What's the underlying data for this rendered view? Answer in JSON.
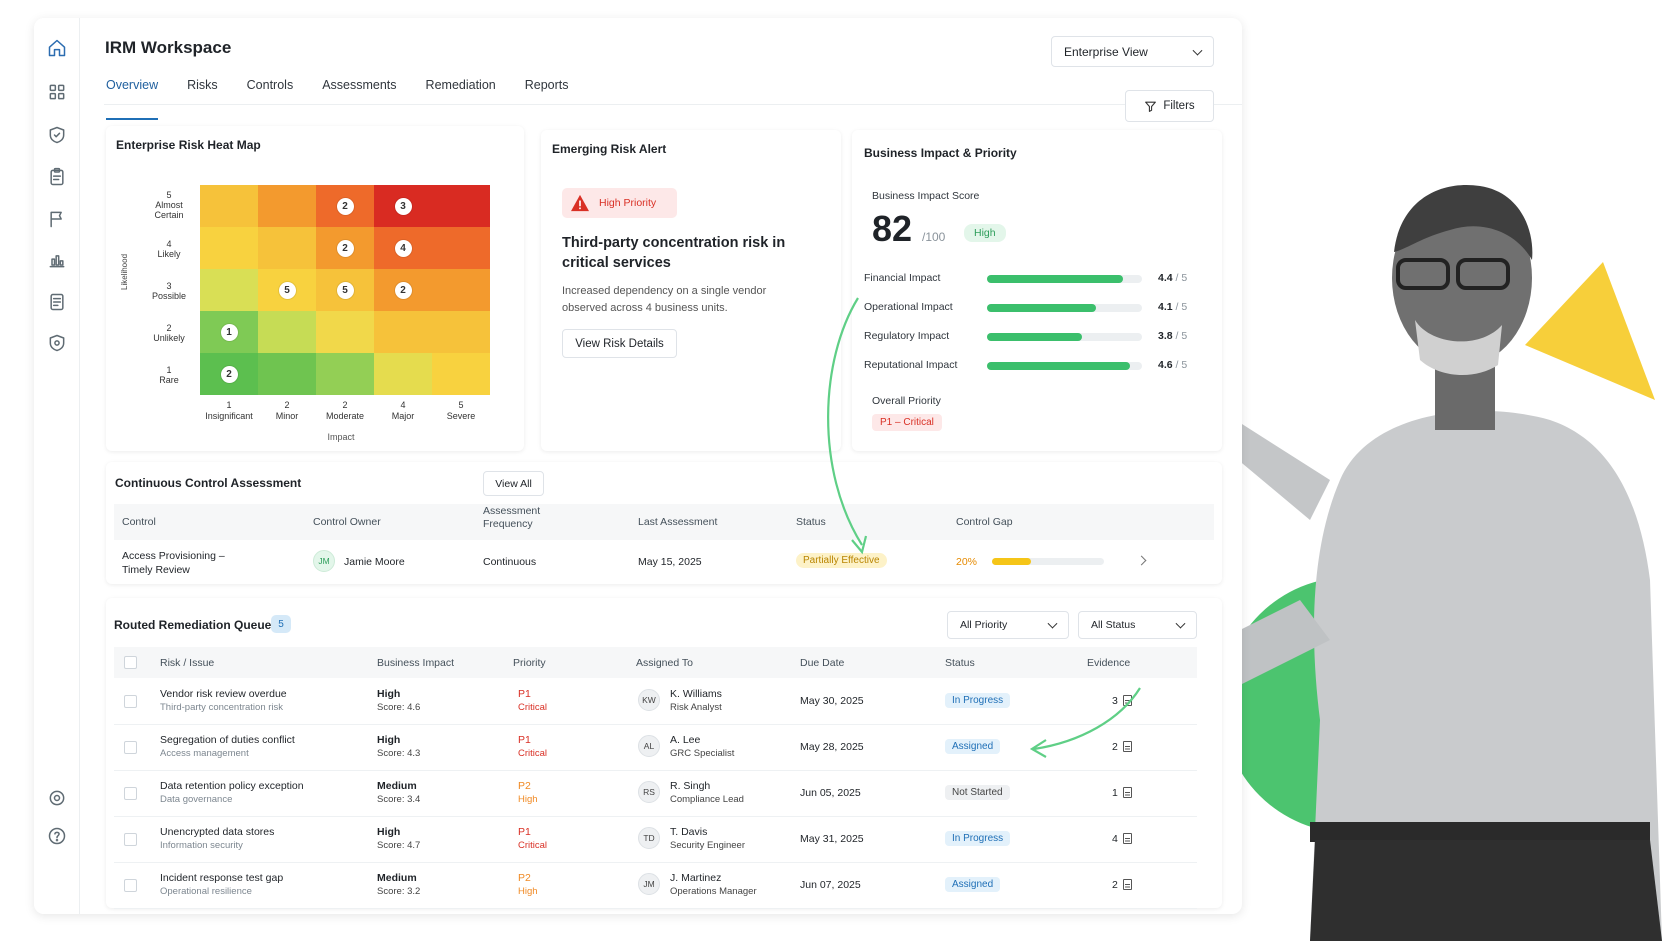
{
  "app": {
    "title": "IRM Workspace"
  },
  "tabs": [
    "Overview",
    "Risks",
    "Controls",
    "Assessments",
    "Remediation",
    "Reports"
  ],
  "view_select": "Enterprise View",
  "filters_label": "Filters",
  "rail_icons": [
    "home-icon",
    "grid-icon",
    "shield-check-icon",
    "clipboard-icon",
    "flag-icon",
    "bar-chart-icon",
    "document-icon",
    "shield-star-icon",
    "settings-icon",
    "help-icon"
  ],
  "heatmap": {
    "title": "Enterprise Risk Heat Map",
    "y_axis": "Likelihood",
    "x_axis": "Impact",
    "rows": [
      {
        "num": "5",
        "label": "Almost Certain",
        "counts": [
          "",
          "",
          "2",
          "3",
          ""
        ]
      },
      {
        "num": "4",
        "label": "Likely",
        "counts": [
          "",
          "",
          "2",
          "4",
          ""
        ]
      },
      {
        "num": "3",
        "label": "Possible",
        "counts": [
          "",
          "5",
          "5",
          "2",
          ""
        ]
      },
      {
        "num": "2",
        "label": "Unlikely",
        "counts": [
          "1",
          "",
          "",
          "",
          ""
        ]
      },
      {
        "num": "1",
        "label": "Rare",
        "counts": [
          "2",
          "",
          "",
          "",
          ""
        ]
      }
    ],
    "cols": [
      {
        "num": "1",
        "label": "Insignificant"
      },
      {
        "num": "2",
        "label": "Minor"
      },
      {
        "num": "2",
        "label": "Moderate"
      },
      {
        "num": "4",
        "label": "Major"
      },
      {
        "num": "5",
        "label": "Severe"
      }
    ],
    "colors": [
      [
        "#f6c23a",
        "#f39a2e",
        "#ee6a2a",
        "#d92b22",
        "#d92b22"
      ],
      [
        "#f8d23f",
        "#f6c23a",
        "#f39a2e",
        "#ee6a2a",
        "#ee6a2a"
      ],
      [
        "#d9df55",
        "#f8d23f",
        "#f6c23a",
        "#f39a2e",
        "#f39a2e"
      ],
      [
        "#7fca55",
        "#c6dc55",
        "#f1d84a",
        "#f6c23a",
        "#f6c23a"
      ],
      [
        "#5cbf4f",
        "#6fc450",
        "#93cf55",
        "#e5dc4e",
        "#f8d23f"
      ]
    ]
  },
  "alert": {
    "title": "Emerging Risk Alert",
    "badge": "High Priority",
    "headline": "Third-party concentration risk in critical services",
    "body": "Increased dependency on a single vendor observed across 4 business units.",
    "button": "View Risk Details"
  },
  "impact": {
    "title": "Business Impact & Priority",
    "score_label": "Business Impact Score",
    "score": "82",
    "score_max": "/100",
    "score_badge": "High",
    "items": [
      {
        "label": "Financial Impact",
        "value": "4.4",
        "max": "/ 5",
        "fraction": 0.88
      },
      {
        "label": "Operational Impact",
        "value": "4.1",
        "max": "/ 5",
        "fraction": 0.7
      },
      {
        "label": "Regulatory Impact",
        "value": "3.8",
        "max": "/ 5",
        "fraction": 0.61
      },
      {
        "label": "Reputational Impact",
        "value": "4.6",
        "max": "/ 5",
        "fraction": 0.92
      }
    ],
    "overall_label": "Overall Priority",
    "overall_value": "P1 – Critical"
  },
  "controls": {
    "title": "Continuous Control Assessment",
    "view_all": "View All",
    "headers": [
      "Control",
      "Control Owner",
      "Assessment Frequency",
      "Last Assessment",
      "Status",
      "Control Gap"
    ],
    "row": {
      "control": "Access Provisioning – Timely Review",
      "owner_initials": "JM",
      "owner": "Jamie Moore",
      "frequency": "Continuous",
      "last": "May 15, 2025",
      "status": "Partially Effective",
      "gap": "20%",
      "gap_fraction": 0.35
    }
  },
  "queue": {
    "title": "Routed Remediation Queue",
    "count": "5",
    "priority_filter": "All Priority",
    "status_filter": "All Status",
    "headers": [
      "Risk / Issue",
      "Business Impact",
      "Priority",
      "Assigned To",
      "Due Date",
      "Status",
      "Evidence"
    ],
    "rows": [
      {
        "issue": "Vendor risk review overdue",
        "issue_sub": "Third-party concentration risk",
        "impact": "High",
        "score": "Score: 4.6",
        "prio": "P1",
        "prio_label": "Critical",
        "initials": "KW",
        "assignee": "K. Williams",
        "role": "Risk Analyst",
        "due": "May 30, 2025",
        "status": "In Progress",
        "evidence": "3"
      },
      {
        "issue": "Segregation of duties conflict",
        "issue_sub": "Access management",
        "impact": "High",
        "score": "Score: 4.3",
        "prio": "P1",
        "prio_label": "Critical",
        "initials": "AL",
        "assignee": "A. Lee",
        "role": "GRC Specialist",
        "due": "May 28, 2025",
        "status": "Assigned",
        "evidence": "2"
      },
      {
        "issue": "Data retention policy exception",
        "issue_sub": "Data governance",
        "impact": "Medium",
        "score": "Score: 3.4",
        "prio": "P2",
        "prio_label": "High",
        "initials": "RS",
        "assignee": "R. Singh",
        "role": "Compliance Lead",
        "due": "Jun 05, 2025",
        "status": "Not Started",
        "evidence": "1"
      },
      {
        "issue": "Unencrypted data stores",
        "issue_sub": "Information security",
        "impact": "High",
        "score": "Score: 4.7",
        "prio": "P1",
        "prio_label": "Critical",
        "initials": "TD",
        "assignee": "T. Davis",
        "role": "Security Engineer",
        "due": "May 31, 2025",
        "status": "In Progress",
        "evidence": "4"
      },
      {
        "issue": "Incident response test gap",
        "issue_sub": "Operational resilience",
        "impact": "Medium",
        "score": "Score: 3.2",
        "prio": "P2",
        "prio_label": "High",
        "initials": "JM",
        "assignee": "J. Martinez",
        "role": "Operations Manager",
        "due": "Jun 07, 2025",
        "status": "Assigned",
        "evidence": "2"
      }
    ]
  },
  "colors": {
    "accent": "#1f6fb6",
    "green": "#3bbf6c",
    "critical": "#d93025",
    "high": "#f08a24",
    "brand_yellow": "#f7cf3a"
  }
}
